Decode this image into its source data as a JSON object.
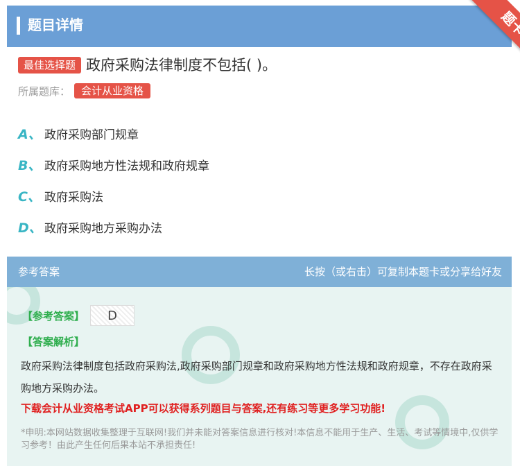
{
  "header": {
    "title": "题目详情",
    "corner_badge": "题卡"
  },
  "question": {
    "type_tag": "最佳选择题",
    "text": "政府采购法律制度不包括( )。",
    "bank_label": "所属题库：",
    "bank_name": "会计从业资格"
  },
  "options": [
    {
      "letter": "A、",
      "text": "政府采购部门规章"
    },
    {
      "letter": "B、",
      "text": "政府采购地方性法规和政府规章"
    },
    {
      "letter": "C、",
      "text": "政府采购法"
    },
    {
      "letter": "D、",
      "text": "政府采购地方采购办法"
    }
  ],
  "answer_section": {
    "title": "参考答案",
    "share_hint": "长按（或右击）可复制本题卡或分享给好友",
    "answer_label": "【参考答案】",
    "answer_value": "D",
    "analysis_label": "【答案解析】",
    "analysis_text": "政府采购法律制度包括政府采购法,政府采购部门规章和政府采购地方性法规和政府规章，不存在政府采购地方采购办法。",
    "promo_text": "下载会计从业资格考试APP可以获得系列题目与答案,还有练习等更多学习功能!",
    "disclaimer": "*申明:本网站数据收集整理于互联网!我们并未能对答案信息进行核对!本信息不能用于生产、生活、考试等情境中,仅供学习参考！由此产生任何后果本站不承担责任!"
  },
  "colors": {
    "header_bg": "#6b9fd6",
    "tag_red": "#e55347",
    "option_letter": "#39b5c4",
    "answer_bg": "#e8f4f2",
    "answer_head_bg": "#7fb0d7",
    "label_green": "#2fae4e",
    "promo_red": "#e02020"
  }
}
